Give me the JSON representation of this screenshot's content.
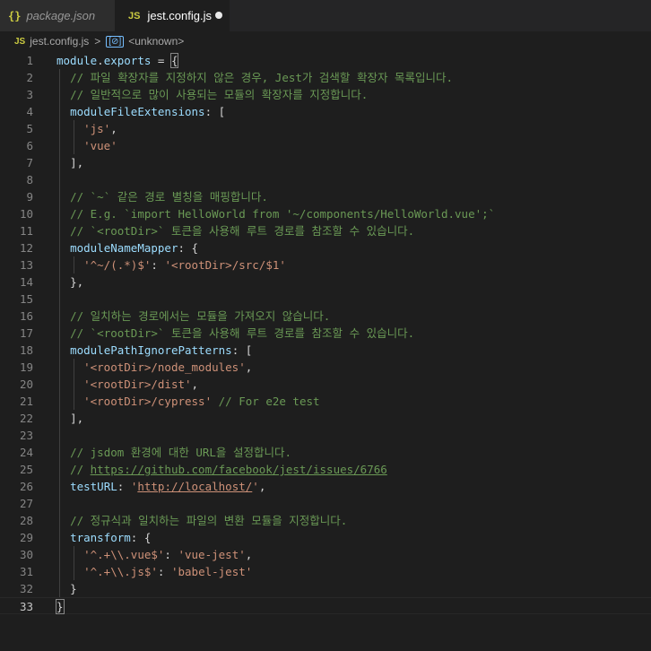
{
  "tabs": [
    {
      "icon": "{}",
      "label": "package.json"
    },
    {
      "icon": "JS",
      "label": "jest.config.js"
    }
  ],
  "breadcrumb": {
    "file_icon": "JS",
    "file": "jest.config.js",
    "separator": ">",
    "symbol_icon": "[⊘]",
    "symbol": "<unknown>"
  },
  "editor": {
    "lines": [
      {
        "n": "1",
        "indent": 0,
        "t": [
          [
            "v",
            "module"
          ],
          [
            "p",
            "."
          ],
          [
            "v",
            "exports"
          ],
          [
            "p",
            " = "
          ],
          [
            "b",
            "{"
          ]
        ]
      },
      {
        "n": "2",
        "indent": 1,
        "t": [
          [
            "c",
            "// 파일 확장자를 지정하지 않은 경우, Jest가 검색할 확장자 목록입니다."
          ]
        ]
      },
      {
        "n": "3",
        "indent": 1,
        "t": [
          [
            "c",
            "// 일반적으로 많이 사용되는 모듈의 확장자를 지정합니다."
          ]
        ]
      },
      {
        "n": "4",
        "indent": 1,
        "t": [
          [
            "v",
            "moduleFileExtensions"
          ],
          [
            "p",
            ": ["
          ]
        ]
      },
      {
        "n": "5",
        "indent": 2,
        "t": [
          [
            "s",
            "'js'"
          ],
          [
            "p",
            ","
          ]
        ]
      },
      {
        "n": "6",
        "indent": 2,
        "t": [
          [
            "s",
            "'vue'"
          ]
        ]
      },
      {
        "n": "7",
        "indent": 1,
        "t": [
          [
            "p",
            "],"
          ]
        ]
      },
      {
        "n": "8",
        "indent": 1,
        "t": []
      },
      {
        "n": "9",
        "indent": 1,
        "t": [
          [
            "c",
            "// `~` 같은 경로 별칭을 매핑합니다."
          ]
        ]
      },
      {
        "n": "10",
        "indent": 1,
        "t": [
          [
            "c",
            "// E.g. `import HelloWorld from '~/components/HelloWorld.vue';`"
          ]
        ]
      },
      {
        "n": "11",
        "indent": 1,
        "t": [
          [
            "c",
            "// `<rootDir>` 토큰을 사용해 루트 경로를 참조할 수 있습니다."
          ]
        ]
      },
      {
        "n": "12",
        "indent": 1,
        "t": [
          [
            "v",
            "moduleNameMapper"
          ],
          [
            "p",
            ": {"
          ]
        ]
      },
      {
        "n": "13",
        "indent": 2,
        "t": [
          [
            "s",
            "'^~/(.*)$'"
          ],
          [
            "p",
            ": "
          ],
          [
            "s",
            "'<rootDir>/src/$1'"
          ]
        ]
      },
      {
        "n": "14",
        "indent": 1,
        "t": [
          [
            "p",
            "},"
          ]
        ]
      },
      {
        "n": "15",
        "indent": 1,
        "t": []
      },
      {
        "n": "16",
        "indent": 1,
        "t": [
          [
            "c",
            "// 일치하는 경로에서는 모듈을 가져오지 않습니다."
          ]
        ]
      },
      {
        "n": "17",
        "indent": 1,
        "t": [
          [
            "c",
            "// `<rootDir>` 토큰을 사용해 루트 경로를 참조할 수 있습니다."
          ]
        ]
      },
      {
        "n": "18",
        "indent": 1,
        "t": [
          [
            "v",
            "modulePathIgnorePatterns"
          ],
          [
            "p",
            ": ["
          ]
        ]
      },
      {
        "n": "19",
        "indent": 2,
        "t": [
          [
            "s",
            "'<rootDir>/node_modules'"
          ],
          [
            "p",
            ","
          ]
        ]
      },
      {
        "n": "20",
        "indent": 2,
        "t": [
          [
            "s",
            "'<rootDir>/dist'"
          ],
          [
            "p",
            ","
          ]
        ]
      },
      {
        "n": "21",
        "indent": 2,
        "t": [
          [
            "s",
            "'<rootDir>/cypress'"
          ],
          [
            "p",
            " "
          ],
          [
            "c",
            "// For e2e test"
          ]
        ]
      },
      {
        "n": "22",
        "indent": 1,
        "t": [
          [
            "p",
            "],"
          ]
        ]
      },
      {
        "n": "23",
        "indent": 1,
        "t": []
      },
      {
        "n": "24",
        "indent": 1,
        "t": [
          [
            "c",
            "// jsdom 환경에 대한 URL을 설정합니다."
          ]
        ]
      },
      {
        "n": "25",
        "indent": 1,
        "t": [
          [
            "c",
            "// "
          ],
          [
            "cu",
            "https://github.com/facebook/jest/issues/6766"
          ]
        ]
      },
      {
        "n": "26",
        "indent": 1,
        "t": [
          [
            "v",
            "testURL"
          ],
          [
            "p",
            ": "
          ],
          [
            "s",
            "'"
          ],
          [
            "su",
            "http://localhost/"
          ],
          [
            "s",
            "'"
          ],
          [
            "p",
            ","
          ]
        ]
      },
      {
        "n": "27",
        "indent": 1,
        "t": []
      },
      {
        "n": "28",
        "indent": 1,
        "t": [
          [
            "c",
            "// 정규식과 일치하는 파일의 변환 모듈을 지정합니다."
          ]
        ]
      },
      {
        "n": "29",
        "indent": 1,
        "t": [
          [
            "v",
            "transform"
          ],
          [
            "p",
            ": {"
          ]
        ]
      },
      {
        "n": "30",
        "indent": 2,
        "t": [
          [
            "s",
            "'^.+\\\\.vue$'"
          ],
          [
            "p",
            ": "
          ],
          [
            "s",
            "'vue-jest'"
          ],
          [
            "p",
            ","
          ]
        ]
      },
      {
        "n": "31",
        "indent": 2,
        "t": [
          [
            "s",
            "'^.+\\\\.js$'"
          ],
          [
            "p",
            ": "
          ],
          [
            "s",
            "'babel-jest'"
          ]
        ]
      },
      {
        "n": "32",
        "indent": 1,
        "t": [
          [
            "p",
            "}"
          ]
        ]
      },
      {
        "n": "33",
        "indent": 0,
        "t": [
          [
            "bc",
            "}"
          ]
        ]
      }
    ]
  },
  "colors": {
    "background": "#1e1e1e",
    "string": "#ce9178",
    "comment": "#6a9955",
    "property": "#9cdcfe"
  }
}
